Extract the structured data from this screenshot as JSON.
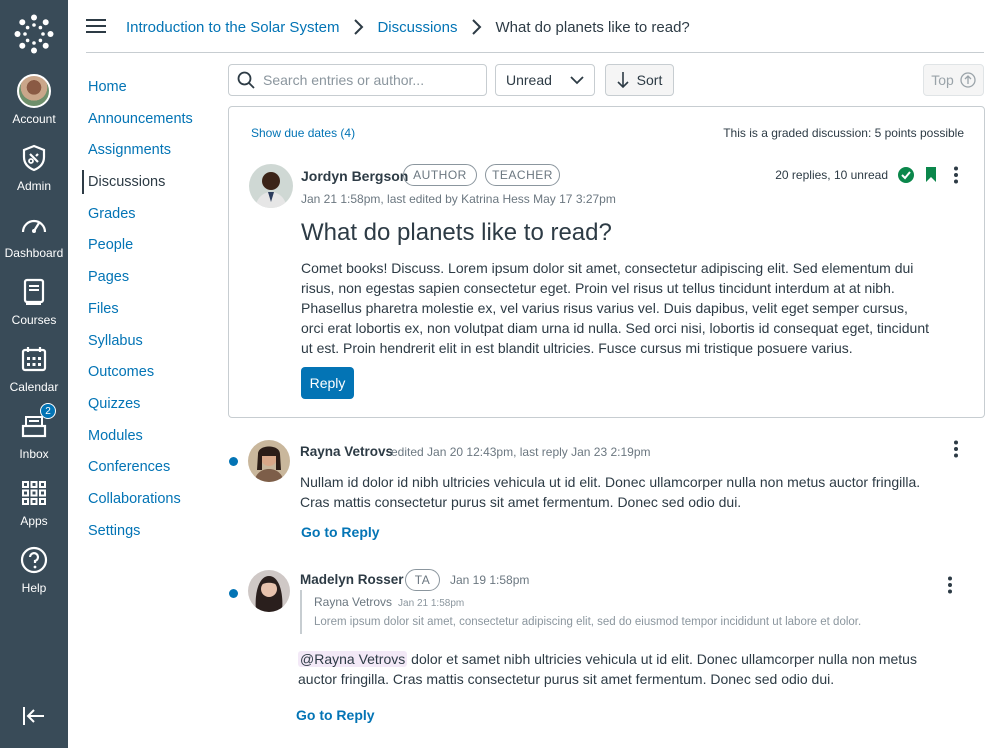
{
  "global_nav": {
    "items": [
      {
        "label": "Account",
        "icon": "account-avatar"
      },
      {
        "label": "Admin",
        "icon": "shield-icon"
      },
      {
        "label": "Dashboard",
        "icon": "dashboard-icon"
      },
      {
        "label": "Courses",
        "icon": "courses-icon"
      },
      {
        "label": "Calendar",
        "icon": "calendar-icon"
      },
      {
        "label": "Inbox",
        "icon": "inbox-icon",
        "badge": "2"
      },
      {
        "label": "Apps",
        "icon": "apps-icon"
      },
      {
        "label": "Help",
        "icon": "help-icon"
      }
    ],
    "bg_color": "#394b58"
  },
  "breadcrumb": {
    "course": "Introduction to the Solar System",
    "section": "Discussions",
    "current": "What do planets like to read?"
  },
  "course_nav": {
    "items": [
      "Home",
      "Announcements",
      "Assignments",
      "Discussions",
      "Grades",
      "People",
      "Pages",
      "Files",
      "Syllabus",
      "Outcomes",
      "Quizzes",
      "Modules",
      "Conferences",
      "Collaborations",
      "Settings"
    ],
    "active": "Discussions"
  },
  "toolbar": {
    "search_placeholder": "Search entries or author...",
    "filter_value": "Unread",
    "sort_label": "Sort",
    "top_label": "Top"
  },
  "topic": {
    "due_dates_link": "Show due dates (4)",
    "graded_note": "This is a graded discussion: 5 points possible",
    "author": "Jordyn Bergson",
    "roles": [
      "AUTHOR",
      "TEACHER"
    ],
    "meta": "Jan 21 1:58pm, last edited by Katrina Hess May 17 3:27pm",
    "reply_count": "20 replies, 10 unread",
    "title": "What do planets like to read?",
    "body": "Comet books! Discuss. Lorem ipsum dolor sit amet, consectetur adipiscing elit. Sed elementum dui risus, non egestas sapien consectetur eget. Proin vel risus ut tellus tincidunt interdum at at nibh. Phasellus pharetra molestie ex, vel varius risus varius vel. Duis dapibus, velit eget semper cursus, orci erat lobortis ex, non volutpat diam urna id nulla. Sed orci nisi, lobortis id consequat eget, tincidunt ut est. Proin hendrerit elit in est blandit ultricies. Fusce cursus mi tristique posuere varius.",
    "reply_label": "Reply"
  },
  "entries": [
    {
      "author": "Rayna Vetrovs",
      "meta": "edited Jan 20 12:43pm, last reply Jan 23 2:19pm",
      "body": "Nullam id dolor id nibh ultricies vehicula ut id elit. Donec ullamcorper nulla non metus auctor fringilla. Cras mattis consectetur purus sit amet fermentum. Donec sed odio dui.",
      "go_reply": "Go to Reply"
    },
    {
      "author": "Madelyn Rosser",
      "role": "TA",
      "meta": "Jan 19 1:58pm",
      "quote_author": "Rayna Vetrovs",
      "quote_date": "Jan 21 1:58pm",
      "quote_text": "Lorem ipsum dolor sit amet, consectetur adipiscing elit, sed do eiusmod tempor incididunt ut labore et dolor.",
      "mention": "@Rayna Vetrovs",
      "body": " dolor et samet nibh ultricies vehicula ut id elit. Donec ullamcorper nulla non metus auctor fringilla. Cras mattis consectetur purus sit amet fermentum. Donec sed odio dui.",
      "go_reply": "Go to Reply"
    }
  ],
  "colors": {
    "link": "#0374b5",
    "success": "#0b874b",
    "text": "#2d3b45"
  }
}
